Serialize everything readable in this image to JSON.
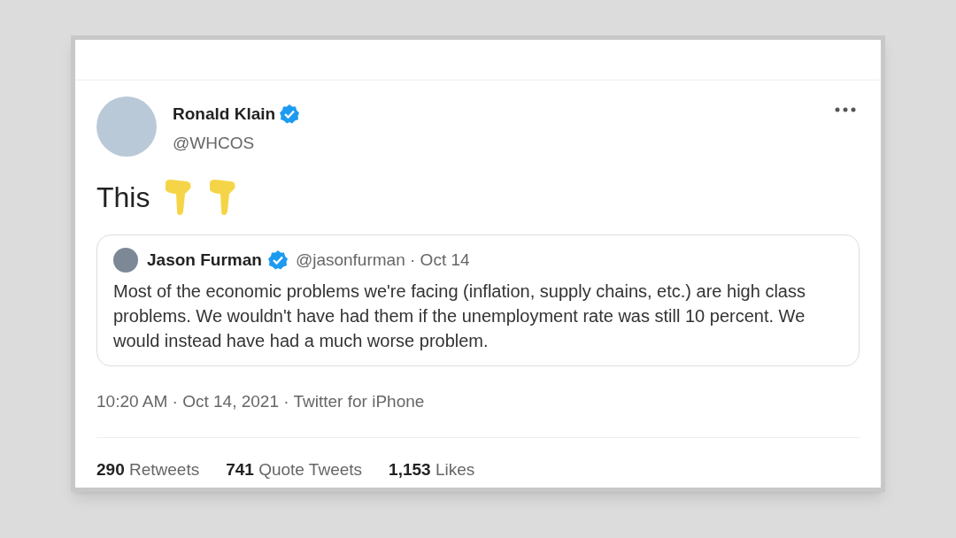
{
  "tweet": {
    "author": {
      "name": "Ronald Klain",
      "handle": "@WHCOS",
      "verified": true
    },
    "text": "This",
    "quoted": {
      "author": "Jason Furman",
      "verified": true,
      "handle_date": "@jasonfurman · Oct 14",
      "text": "Most of the economic problems we're facing (inflation, supply chains, etc.) are high class problems. We wouldn't have had them if the unemployment rate was still 10 percent. We would instead have had a much worse problem."
    },
    "meta": "10:20 AM · Oct 14, 2021 · Twitter for iPhone",
    "stats": [
      "**290** Retweets",
      "**741** Quote Tweets",
      "**1,153** Likes"
    ]
  }
}
